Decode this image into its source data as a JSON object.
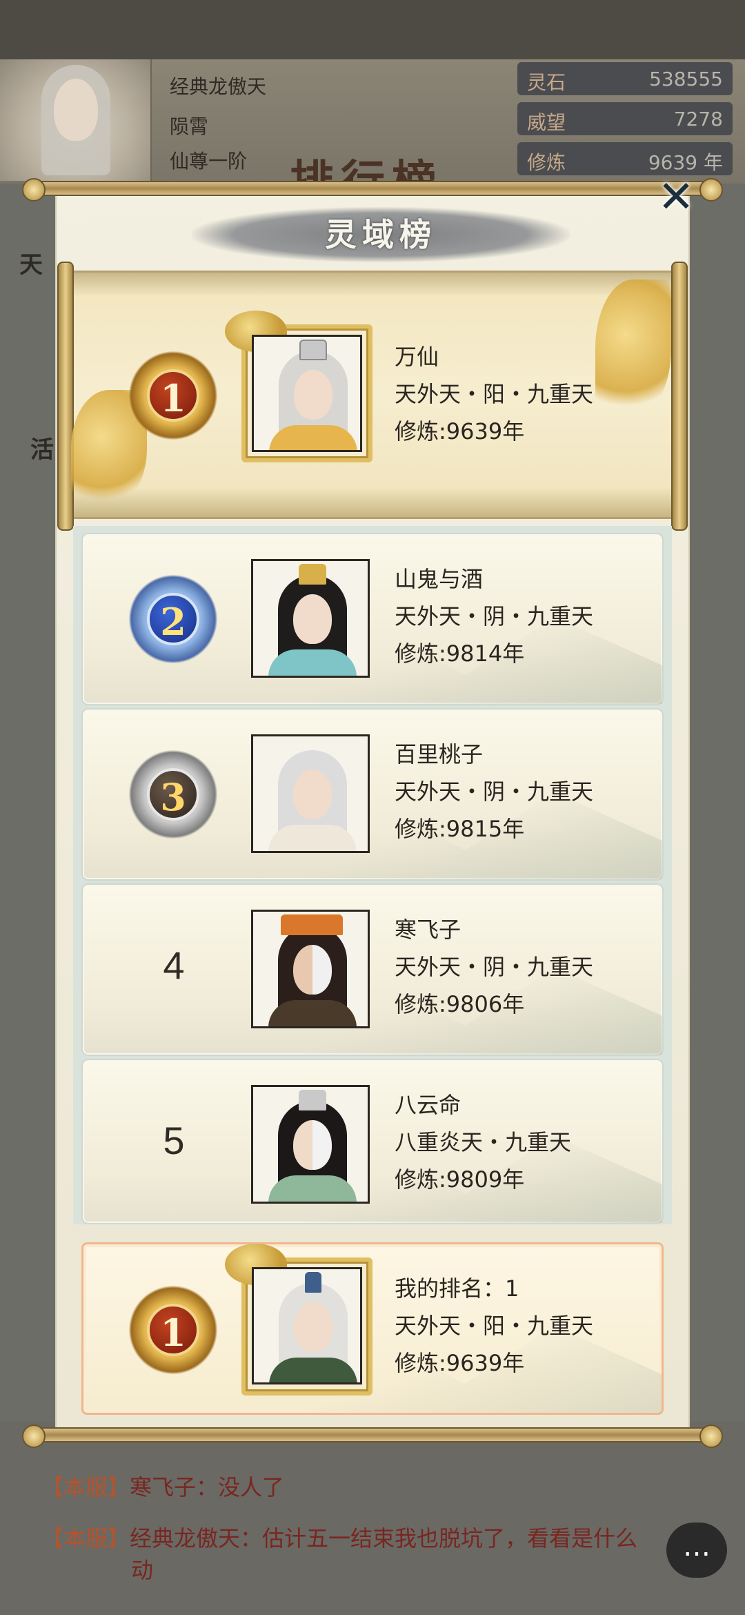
{
  "player": {
    "name": "经典龙傲天",
    "title1": "陨霄",
    "title2": "仙尊一阶"
  },
  "stats": [
    {
      "label": "灵石",
      "value": "538555"
    },
    {
      "label": "威望",
      "value": "7278"
    },
    {
      "label": "修炼",
      "value": "9639 年"
    }
  ],
  "background_title": "排行榜",
  "background_left_glyphs": [
    "天",
    "活"
  ],
  "dialog": {
    "title": "灵域榜",
    "close_glyph": "✕"
  },
  "leaderboard": [
    {
      "rank": "1",
      "name": "万仙",
      "realm": "天外天・阳・九重天",
      "cultivation": "修炼:9639年",
      "badge": "gold"
    },
    {
      "rank": "2",
      "name": "山鬼与酒",
      "realm": "天外天・阴・九重天",
      "cultivation": "修炼:9814年",
      "badge": "blue"
    },
    {
      "rank": "3",
      "name": "百里桃子",
      "realm": "天外天・阴・九重天",
      "cultivation": "修炼:9815年",
      "badge": "silver"
    },
    {
      "rank": "4",
      "name": "寒飞子",
      "realm": "天外天・阴・九重天",
      "cultivation": "修炼:9806年",
      "badge": "none"
    },
    {
      "rank": "5",
      "name": "八云命",
      "realm": "八重炎天・九重天",
      "cultivation": "修炼:9809年",
      "badge": "none"
    }
  ],
  "my_rank": {
    "label": "我的排名：1",
    "rank": "1",
    "realm": "天外天・阳・九重天",
    "cultivation": "修炼:9639年"
  },
  "chat": [
    {
      "tag": "【本服】",
      "text": "寒飞子：没人了"
    },
    {
      "tag": "【本服】",
      "text": "经典龙傲天：估计五一结束我也脱坑了，看看是什么",
      "text2": "动"
    }
  ],
  "chat_button_glyph": "…",
  "colors": {
    "scroll_bg": "#f3efe1",
    "gold": "#e0bf63",
    "text": "#2a2520",
    "chat_tag": "#b4532c",
    "chat_text": "#7a2620"
  }
}
